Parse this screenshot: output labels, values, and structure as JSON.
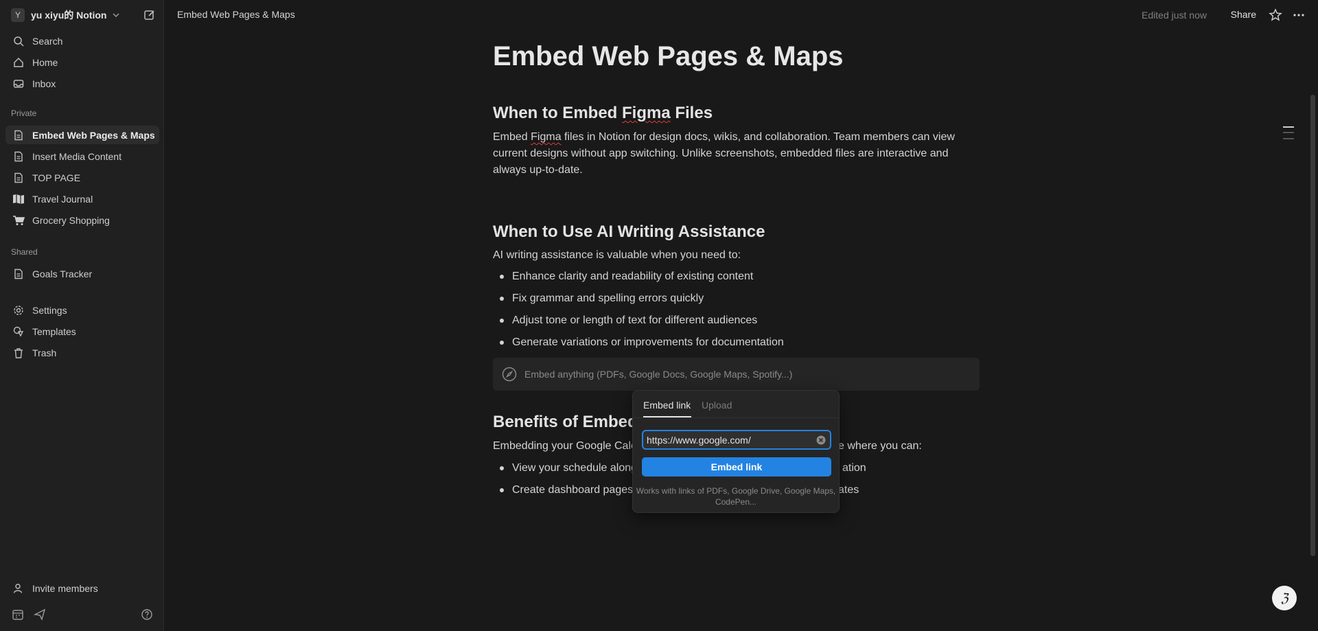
{
  "workspace": {
    "avatar": "Y",
    "name": "yu xiyu的 Notion"
  },
  "sidebar": {
    "top_items": [
      {
        "label": "Search",
        "icon": "search-icon"
      },
      {
        "label": "Home",
        "icon": "home-icon"
      },
      {
        "label": "Inbox",
        "icon": "inbox-icon"
      }
    ],
    "private_label": "Private",
    "private_items": [
      {
        "label": "Embed Web Pages & Maps",
        "icon": "page-icon",
        "active": true
      },
      {
        "label": "Insert Media Content",
        "icon": "page-icon"
      },
      {
        "label": "TOP PAGE",
        "icon": "page-icon"
      },
      {
        "label": "Travel Journal",
        "icon": "map-icon"
      },
      {
        "label": "Grocery Shopping",
        "icon": "cart-icon"
      }
    ],
    "shared_label": "Shared",
    "shared_items": [
      {
        "label": "Goals Tracker",
        "icon": "page-icon"
      }
    ],
    "util_items": [
      {
        "label": "Settings",
        "icon": "gear-icon"
      },
      {
        "label": "Templates",
        "icon": "templates-icon"
      },
      {
        "label": "Trash",
        "icon": "trash-icon"
      }
    ],
    "invite": "Invite members"
  },
  "topbar": {
    "breadcrumb": "Embed Web Pages & Maps",
    "edited": "Edited just now",
    "share": "Share"
  },
  "doc": {
    "title": "Embed Web Pages & Maps",
    "section1": {
      "heading_pre": "When to Embed ",
      "heading_sq": "Figma",
      "heading_post": " Files",
      "para_pre": "Embed ",
      "para_sq": "Figma",
      "para_post": " files in Notion for design docs, wikis, and collaboration. Team members can view current designs without app switching. Unlike screenshots, embedded files are interactive and always up-to-date."
    },
    "section2": {
      "heading": "When to Use AI Writing Assistance",
      "intro": "AI writing assistance is valuable when you need to:",
      "bullets": [
        "Enhance clarity and readability of existing content",
        "Fix grammar and spelling errors quickly",
        "Adjust tone or length of text for different audiences",
        "Generate variations or improvements for documentation"
      ]
    },
    "embed_placeholder": "Embed anything (PDFs, Google Docs, Google Maps, Spotify...)",
    "section3": {
      "heading_visible": "Benefits of Embedc",
      "para_left": "Embedding your Google Cale",
      "para_right": "e where you can:",
      "bullet1_left": "View your schedule along",
      "bullet1_right": "ation",
      "bullet2_left": "Create dashboard pages",
      "bullet2_right": "ates"
    }
  },
  "popover": {
    "tab_embed": "Embed link",
    "tab_upload": "Upload",
    "url_value": "https://www.google.com/",
    "button": "Embed link",
    "hint": "Works with links of PDFs, Google Drive, Google Maps, CodePen..."
  },
  "colors": {
    "accent": "#2383e2",
    "background": "#191919",
    "sidebar": "#202020"
  }
}
